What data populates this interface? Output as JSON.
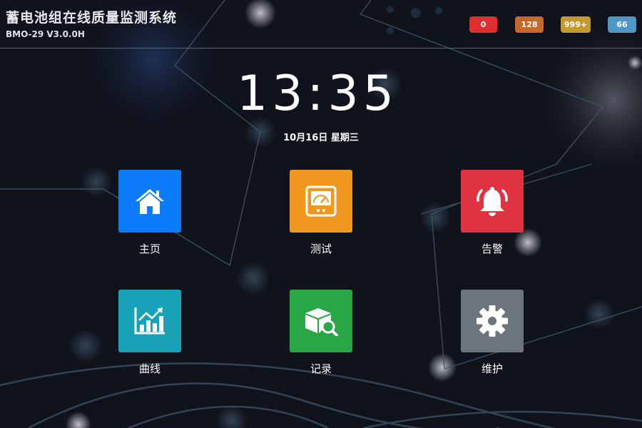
{
  "header": {
    "title": "蓄电池组在线质量监测系统",
    "version": "BMO-29 V3.0.0H"
  },
  "badges": [
    {
      "value": "0",
      "color": "#e02d2d"
    },
    {
      "value": "128",
      "color": "#c8692b"
    },
    {
      "value": "999+",
      "color": "#c49a2c"
    },
    {
      "value": "66",
      "color": "#4f97c6"
    }
  ],
  "clock": {
    "time": "13:35",
    "date": "10月16日 星期三"
  },
  "menu": [
    {
      "label": "主页",
      "icon": "home-icon",
      "color": "#0d7cfb"
    },
    {
      "label": "测试",
      "icon": "meter-icon",
      "color": "#f0981e"
    },
    {
      "label": "告警",
      "icon": "bell-icon",
      "color": "#e03240"
    },
    {
      "label": "曲线",
      "icon": "chart-icon",
      "color": "#17a2b8"
    },
    {
      "label": "记录",
      "icon": "box-search-icon",
      "color": "#28a745"
    },
    {
      "label": "维护",
      "icon": "gear-icon",
      "color": "#6c757d"
    }
  ]
}
